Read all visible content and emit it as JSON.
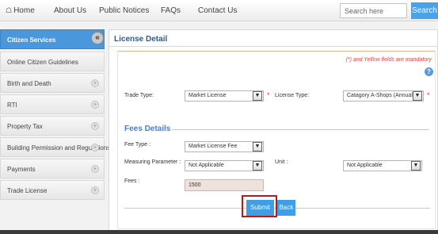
{
  "nav": {
    "home": "Home",
    "about": "About Us",
    "notices": "Public Notices",
    "faqs": "FAQs",
    "contact": "Contact Us",
    "home_icon": "home-icon"
  },
  "search": {
    "placeholder": "Search here",
    "button": "Search"
  },
  "sidebar": {
    "items": [
      {
        "label": "Citizen Services"
      },
      {
        "label": "Online Citizen Guidelines"
      },
      {
        "label": "Birth and Death"
      },
      {
        "label": "RTI"
      },
      {
        "label": "Property Tax"
      },
      {
        "label": "Building Permission and Regulations"
      },
      {
        "label": "Payments"
      },
      {
        "label": "Trade License"
      }
    ],
    "collapse_symbol": "«",
    "expand_symbol": "+"
  },
  "main": {
    "title": "License Detail",
    "mandatory_note": "(*) and Yellow fields are mandatory",
    "help_symbol": "?",
    "trade_type": {
      "label": "Trade Type:",
      "value": "Market License"
    },
    "license_type": {
      "label": "License Type:",
      "value": "Catagory A-Shops (Annual Tu"
    },
    "required_mark": "*",
    "fees_section": "Fees Details",
    "fee_type": {
      "label": "Fee Type :",
      "value": "Market License Fee"
    },
    "measuring_parameter": {
      "label": "Measuring Parameter :",
      "value": "Not Applicable"
    },
    "unit": {
      "label": "Unit :",
      "value": "Not Applicable"
    },
    "fees": {
      "label": "Fees :",
      "value": "1500"
    },
    "submit": "Submit",
    "back": "Back",
    "dropdown_arrow": "▼"
  },
  "colors": {
    "accent": "#4a97db",
    "button": "#3f9ee6",
    "highlight_border": "#b11b1b",
    "required": "#e03b3b",
    "title": "#2d5b8f"
  }
}
